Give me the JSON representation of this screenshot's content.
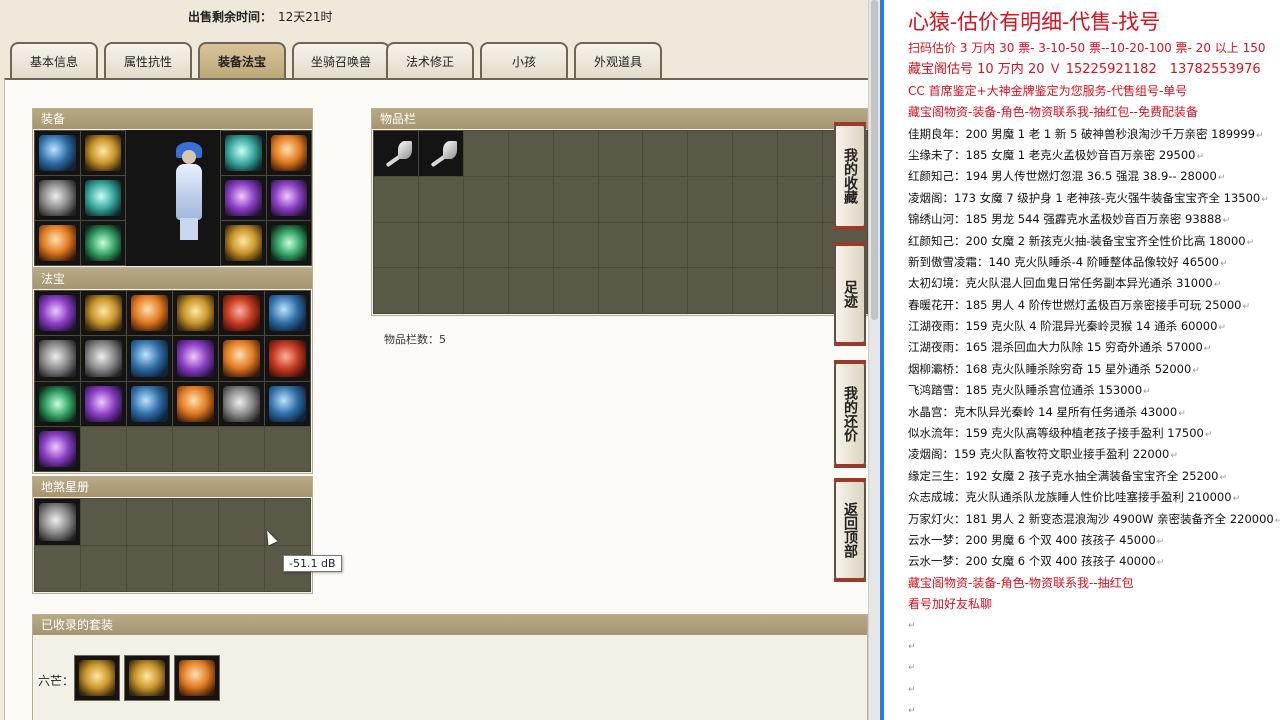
{
  "sale": {
    "label": "出售剩余时间：",
    "value": "12天21时"
  },
  "tabs": [
    {
      "label": "基本信息"
    },
    {
      "label": "属性抗性"
    },
    {
      "label": "装备法宝",
      "active": true
    },
    {
      "label": "坐骑召唤兽"
    },
    {
      "label": "法术修正"
    },
    {
      "label": "小孩"
    },
    {
      "label": "外观道具"
    }
  ],
  "sections": {
    "equipment": "装备",
    "inventory": "物品栏",
    "treasure": "法宝",
    "earth_book": "地煞星册",
    "suits": "已收录的套装"
  },
  "inventory_count": "物品栏数：5",
  "suit_label": "六芒：",
  "side_buttons": [
    {
      "label": "我的收藏"
    },
    {
      "label": "足迹"
    },
    {
      "label": "我的还价"
    },
    {
      "label": "返回顶部"
    }
  ],
  "tooltip": "-51.1 dB",
  "icons": {
    "equipment": [
      "blue",
      "gold",
      "grey",
      "teal",
      "orange",
      "green"
    ],
    "equipment_right": [
      "teal",
      "orange",
      "purple",
      "purple",
      "gold",
      "green"
    ],
    "treasure": [
      "purple",
      "gold",
      "orange",
      "gold",
      "red",
      "blue",
      "grey",
      "grey",
      "blue",
      "purple",
      "orange",
      "red",
      "green",
      "purple",
      "blue",
      "orange",
      "grey",
      "blue",
      "purple"
    ]
  },
  "notes": {
    "title": "心猿-估价有明细-代售-找号",
    "red_lines": [
      "扫码估价 3 万内 30 票- 3-10-50 票--10-20-100 票- 20 以上 150",
      "藏宝阁估号 10 万内 20 Ｖ 15225921182　13782553976",
      "CC 首席鉴定+大神金牌鉴定为您服务-代售组号-单号",
      "藏宝阁物资-装备-角色-物资联系我-抽红包--免费配装备"
    ],
    "entries": [
      "佳期良年：200 男魔 1 老 1 新 5 破神兽秒浪淘沙千万亲密 189999",
      "尘缘未了：185 女魔 1 老克火孟极妙音百万亲密 29500",
      "红颜知己：194 男人传世燃灯忽混 36.5 强混 38.9-- 28000",
      "凌烟阁：173 女魔 7 级护身 1 老神孩-克火强牛装备宝宝齐全 13500",
      "锦绣山河：185 男龙 544 强霹克水孟极妙音百万亲密 93888",
      "红颜知己：200 女魔 2 新孩克火抽-装备宝宝齐全性价比高 18000",
      "新到傲雪凌霜：140 克火队睡杀-4 阶睡整体品像较好 46500",
      "太初幻境：克火队混人回血鬼日常任务副本异光通杀 31000",
      "春暖花开：185 男人 4 阶传世燃灯孟极百万亲密接手可玩 25000",
      "江湖夜雨：159 克火队 4 阶混异光秦岭灵猴 14 通杀 60000",
      "江湖夜雨：165 混杀回血大力队除 15 穷奇外通杀 57000",
      "烟柳灞桥：168 克火队睡杀除穷奇 15 星外通杀 52000",
      "飞鸿踏雪：185 克火队睡杀宫位通杀 153000",
      "水晶宫：克木队异光秦岭 14 星所有任务通杀 43000",
      "似水流年：159 克火队高等级种植老孩子接手盈利 17500",
      "凌烟阁：159 克火队畜牧符文职业接手盈利 22000",
      "缘定三生：192 女魔 2 孩子克水抽全满装备宝宝齐全 25200",
      "众志成城：克火队通杀队龙族睡人性价比哇塞接手盈利 210000",
      "万家灯火：181 男人 2 新变态混浪淘沙 4900W 亲密装备齐全 220000",
      "云水一梦：200 男魔 6 个双 400 孩孩子 45000",
      "云水一梦：200 女魔 6 个双 400 孩孩子 40000"
    ],
    "footer_red": [
      "藏宝阁物资-装备-角色-物资联系我--抽红包",
      "看号加好友私聊"
    ]
  }
}
